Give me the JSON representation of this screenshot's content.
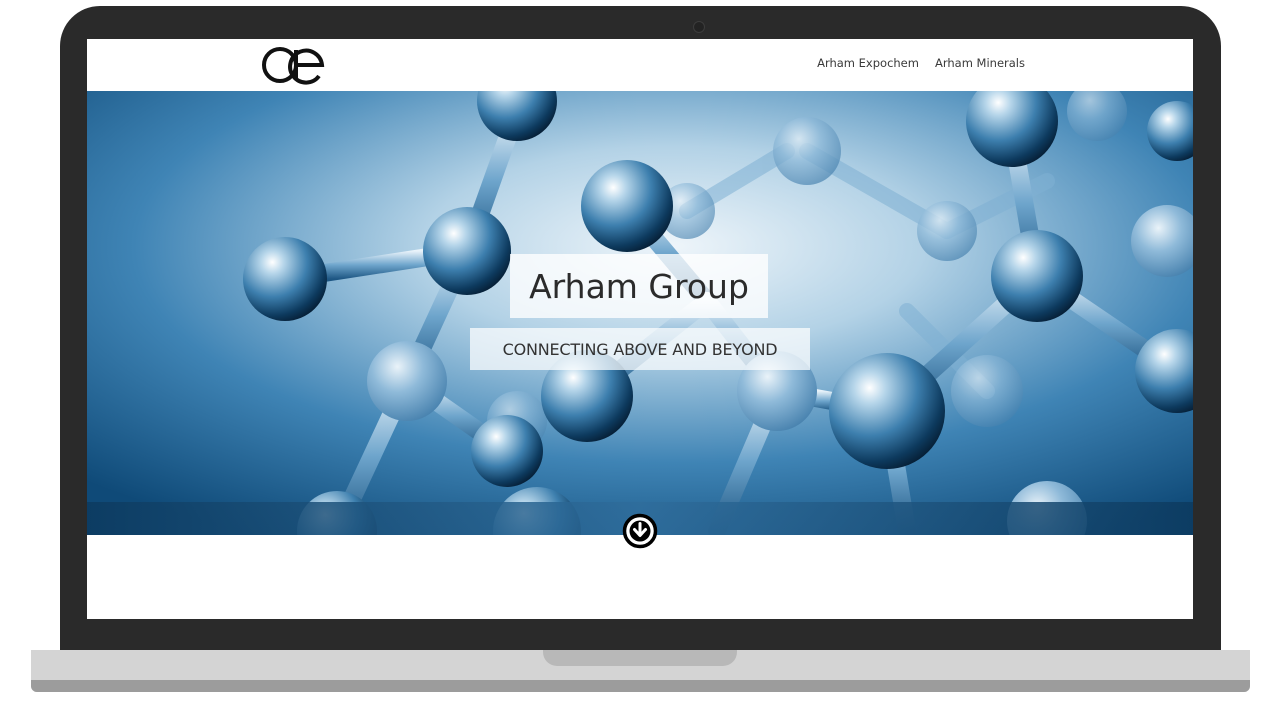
{
  "site": {
    "logo": {
      "icon": "ae-logo-icon",
      "text": "ae"
    },
    "nav": {
      "items": [
        {
          "label": "Arham Expochem"
        },
        {
          "label": "Arham Minerals"
        }
      ]
    }
  },
  "hero": {
    "title": "Arham Group",
    "subtitle": "CONNECTING ABOVE AND BEYOND",
    "background": "molecules-image",
    "scroll_icon": "arrow-down-circle-icon"
  },
  "colors": {
    "bezel": "#2a2a2a",
    "hero_blue_dark": "#0d4773",
    "hero_blue_light": "#e8f2f8",
    "base": "#d4d4d4"
  }
}
